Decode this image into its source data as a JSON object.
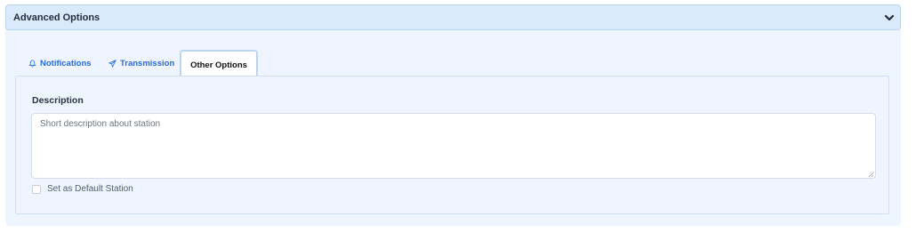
{
  "panel": {
    "title": "Advanced Options",
    "toggle_icon": "chevron-down-icon"
  },
  "tabs": [
    {
      "label": "Notifications",
      "icon": "bell-icon",
      "active": false
    },
    {
      "label": "Transmission",
      "icon": "paper-plane-icon",
      "active": false
    },
    {
      "label": "Other Options",
      "icon": "",
      "active": true
    }
  ],
  "other_options": {
    "description_label": "Description",
    "description_value": "",
    "description_placeholder": "Short description about station",
    "default_checkbox_label": "Set as Default Station",
    "default_checked": false
  },
  "colors": {
    "header_bg": "#dbeafb",
    "panel_bg": "#eef5fe",
    "tab_link": "#2a6ad1",
    "active_tab_border": "#bcd5ef"
  }
}
